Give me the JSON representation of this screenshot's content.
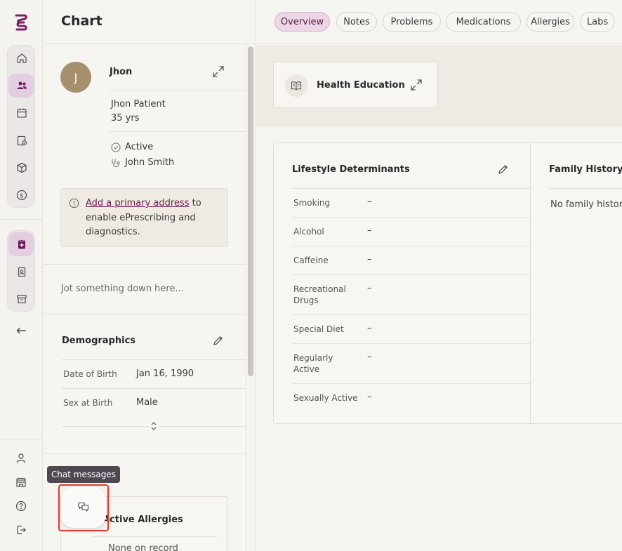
{
  "rail": {
    "icons": [
      "logo-icon",
      "home-icon",
      "patients-icon",
      "calendar-icon",
      "tasks-icon",
      "package-icon",
      "billing-icon",
      "chart-icon",
      "badge-icon",
      "archive-icon",
      "back-arrow-icon",
      "user-icon",
      "building-icon",
      "help-icon",
      "logout-icon"
    ],
    "accent": "#6b1a58"
  },
  "panel": {
    "title": "Chart",
    "patient": {
      "initial": "J",
      "name": "Jhon",
      "full_name": "Jhon Patient",
      "age": "35 yrs",
      "status": "Active",
      "provider": "John Smith"
    },
    "notice": {
      "link": "Add a primary address",
      "text": " to enable ePrescribing and diagnostics."
    },
    "note_placeholder": "Jot something down here...",
    "demographics": {
      "title": "Demographics",
      "rows": [
        {
          "label": "Date of Birth",
          "value": "Jan 16, 1990"
        },
        {
          "label": "Sex at Birth",
          "value": "Male"
        }
      ]
    },
    "allergies": {
      "title": "Active Allergies",
      "empty": "None on record"
    },
    "tooltip": "Chat messages"
  },
  "main": {
    "tabs": [
      {
        "label": "Overview",
        "active": true
      },
      {
        "label": "Notes"
      },
      {
        "label": "Problems"
      },
      {
        "label": "Medications"
      },
      {
        "label": "Allergies"
      },
      {
        "label": "Labs"
      }
    ],
    "health_education": {
      "title": "Health Education"
    },
    "lifestyle": {
      "title": "Lifestyle Determinants",
      "rows": [
        {
          "label": "Smoking",
          "value": "–"
        },
        {
          "label": "Alcohol",
          "value": "–"
        },
        {
          "label": "Caffeine",
          "value": "–"
        },
        {
          "label": "Recreational Drugs",
          "value": "–"
        },
        {
          "label": "Special Diet",
          "value": "–"
        },
        {
          "label": "Regularly Active",
          "value": "–"
        },
        {
          "label": "Sexually Active",
          "value": "–"
        }
      ]
    },
    "family_history": {
      "title": "Family History",
      "empty": "No family history"
    }
  }
}
